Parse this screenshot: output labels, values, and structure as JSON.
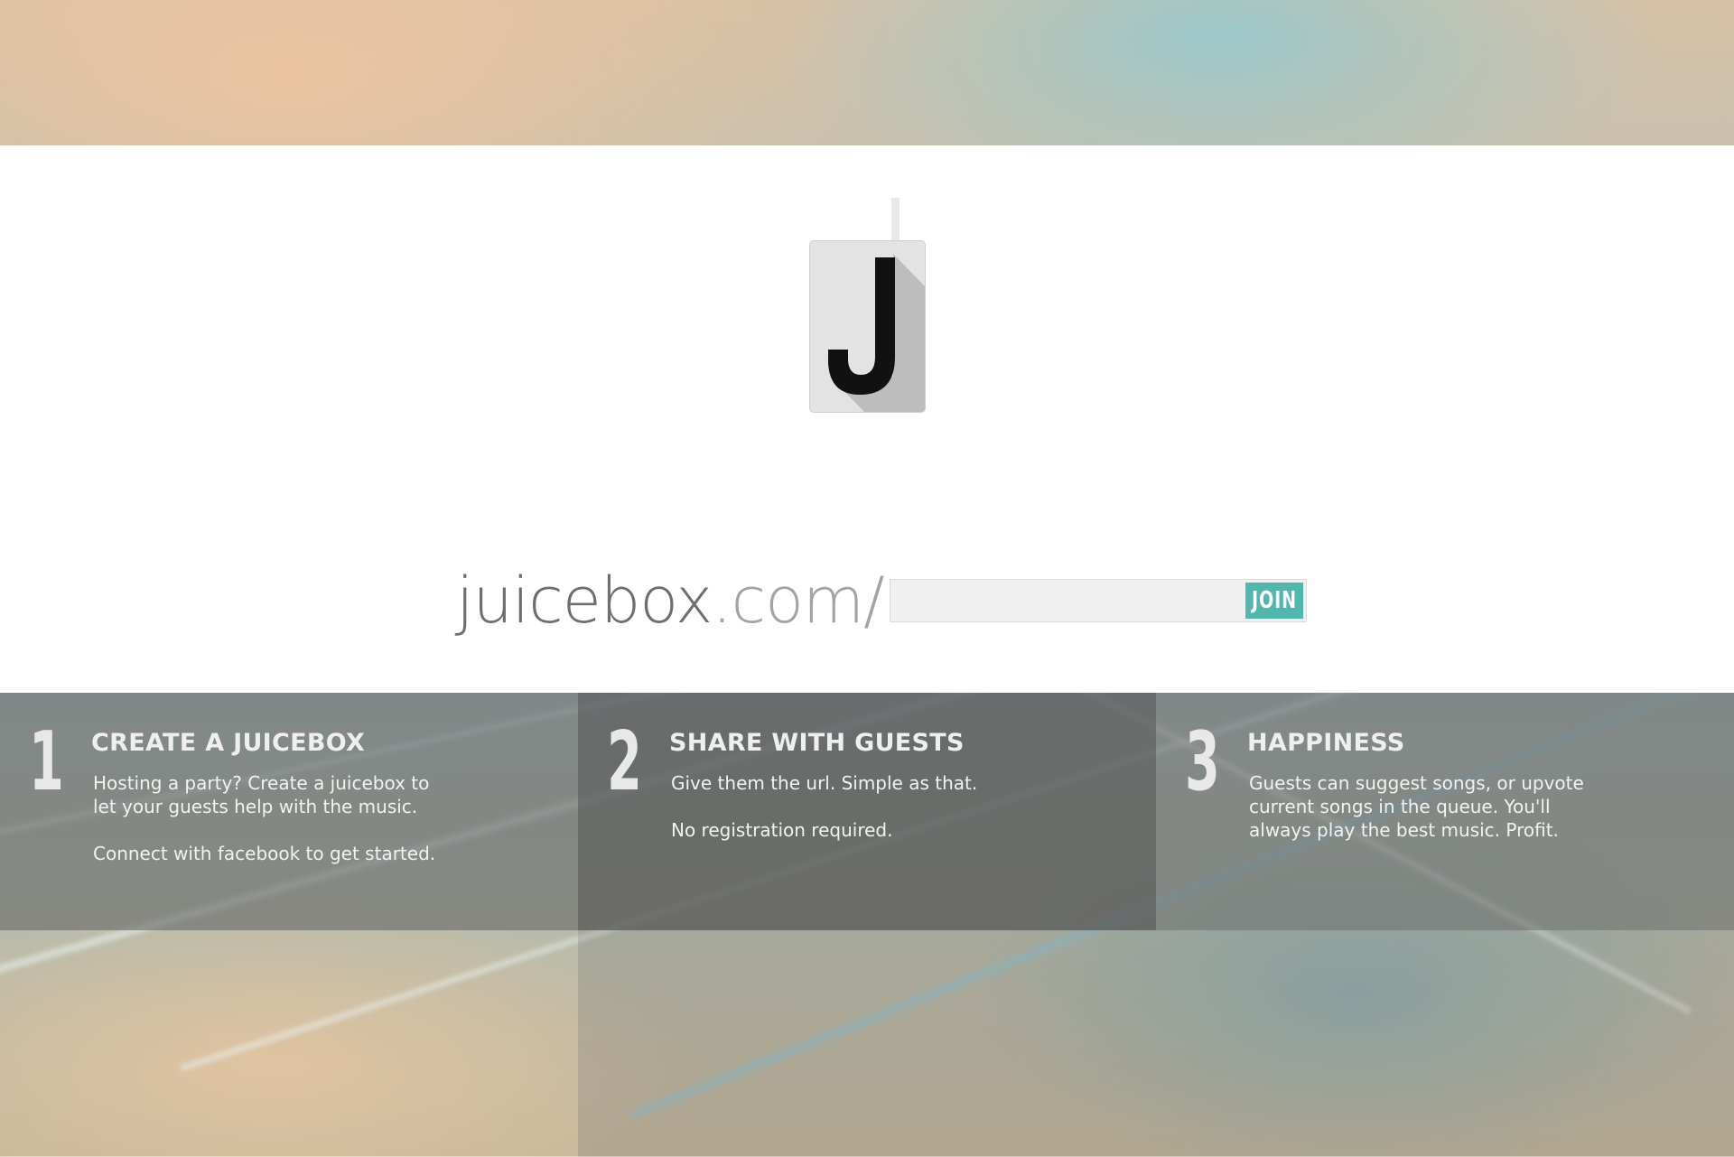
{
  "brand": {
    "logo_letter": "J",
    "url_domain": "juicebox",
    "url_tld": ".com/"
  },
  "join": {
    "input_value": "",
    "button_label": "JOIN"
  },
  "steps": [
    {
      "number": "1",
      "title": "CREATE A JUICEBOX",
      "paragraphs": [
        "Hosting a party?  Create a juicebox to let your guests help with the music.",
        "Connect with facebook to get started."
      ]
    },
    {
      "number": "2",
      "title": "SHARE WITH GUESTS",
      "paragraphs": [
        "Give them the url.  Simple as that.",
        "No registration required."
      ]
    },
    {
      "number": "3",
      "title": "HAPPINESS",
      "paragraphs": [
        "Guests can suggest songs, or upvote current songs in the queue.  You'll always play the best music.  Profit."
      ]
    }
  ],
  "colors": {
    "accent": "#4fb7ab",
    "hero_background": "#ffffff",
    "step_text": "#f2f2f2"
  }
}
